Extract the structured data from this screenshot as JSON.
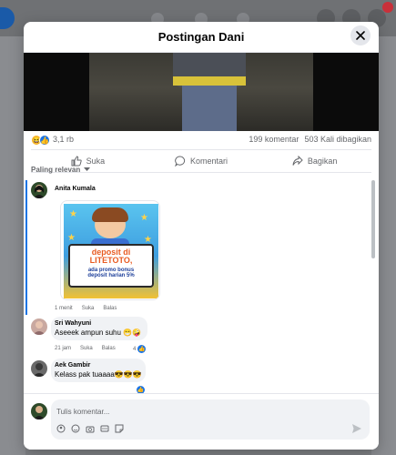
{
  "modal": {
    "title": "Postingan Dani"
  },
  "post": {
    "reaction_count": "3,1 rb",
    "comment_count": "199 komentar",
    "share_count": "503 Kali dibagikan"
  },
  "actions": {
    "like": "Suka",
    "comment": "Komentari",
    "share": "Bagikan"
  },
  "filter": {
    "label": "Paling relevan"
  },
  "comments": [
    {
      "name": "Anita Kumala",
      "text": "",
      "time": "1 menit",
      "like": "Suka",
      "reply": "Balas",
      "sticker": {
        "line1": "deposit di LITETOTO,",
        "line2": "ada promo bonus",
        "line3": "deposit harian 5%"
      }
    },
    {
      "name": "Sri Wahyuni",
      "text": "Aseeek ampun suhu 😁🤪",
      "time": "21 jam",
      "like": "Suka",
      "reply": "Balas",
      "like_count": "4"
    },
    {
      "name": "Aek Gambir",
      "text": "Kelass pak tuaaaa😎😎😎",
      "time": "",
      "like": "",
      "reply": ""
    }
  ],
  "composer": {
    "placeholder": "Tulis komentar..."
  },
  "colors": {
    "accent": "#1b74e4",
    "text": "#050505",
    "muted": "#65676b"
  },
  "icons": [
    "close-icon",
    "like-icon",
    "comment-icon",
    "share-icon",
    "chevron-down-icon",
    "emoji-icon",
    "camera-icon",
    "gif-icon",
    "sticker-icon",
    "send-icon"
  ]
}
